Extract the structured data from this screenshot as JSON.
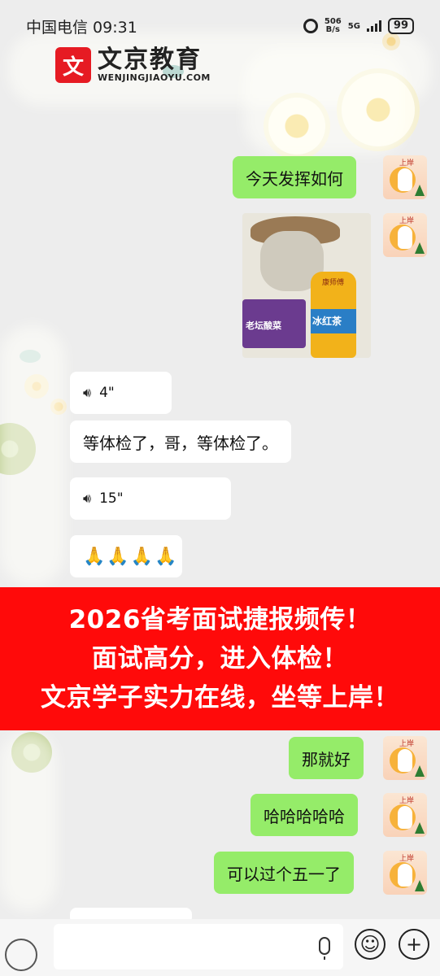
{
  "status_bar": {
    "carrier_time": "中国电信 09:31",
    "net_speed_value": "506",
    "net_speed_unit": "B/s",
    "network_type": "5G",
    "battery": "99"
  },
  "logo": {
    "name": "文京教育",
    "url": "WENJINGJIAOYU.COM",
    "mark": "文"
  },
  "avatar": {
    "tag": "上岸"
  },
  "messages": {
    "m1": "今天发挥如何",
    "voice1": "4\"",
    "m3": "等体检了，哥，等体检了。",
    "voice2": "15\"",
    "m5": "🙏🙏🙏🙏",
    "m6": "那就好",
    "m7": "哈哈哈哈哈",
    "m8": "可以过个五一了"
  },
  "sticker": {
    "pack_text": "老坛酸菜",
    "bottle_text": "冰红茶",
    "top_text": "康师傅"
  },
  "banner": {
    "line1": "2026省考面试捷报频传！",
    "line2": "面试高分，进入体检！",
    "line3": "文京学子实力在线，坐等上岸！"
  },
  "input_bar": {
    "emoji_icon": "☺",
    "plus_icon": "+"
  }
}
